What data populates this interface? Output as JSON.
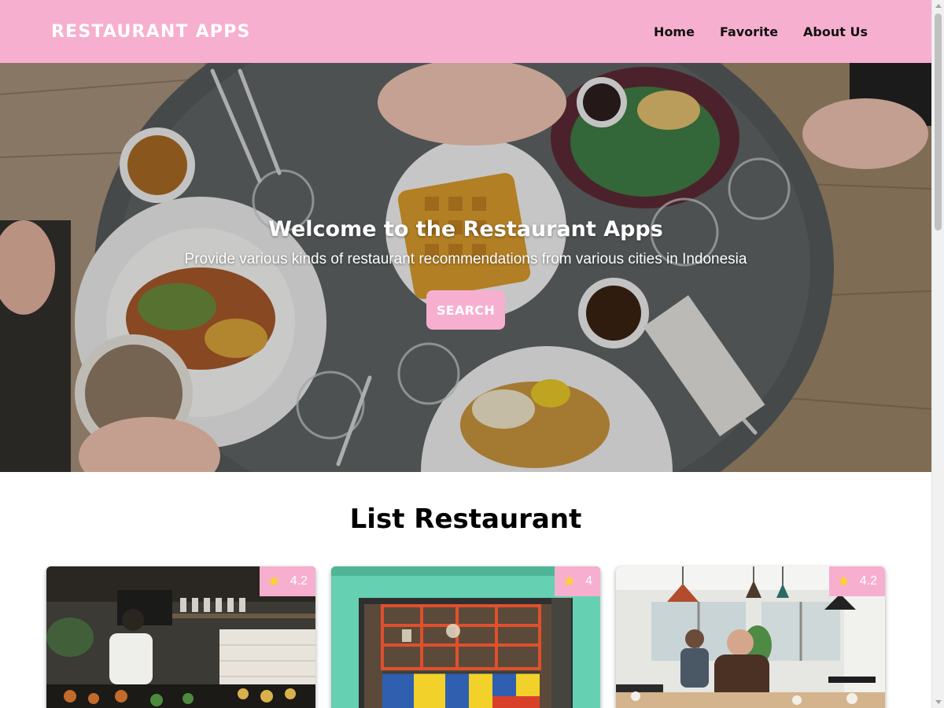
{
  "header": {
    "brand": "RESTAURANT APPS",
    "nav": [
      "Home",
      "Favorite",
      "About Us"
    ]
  },
  "hero": {
    "title": "Welcome to the Restaurant Apps",
    "subtitle": "Provide various kinds of restaurant recommendations from various cities in Indonesia",
    "button_label": "SEARCH"
  },
  "list": {
    "title": "List Restaurant",
    "restaurants": [
      {
        "rating": "4.2",
        "icon": "star-icon"
      },
      {
        "rating": "4",
        "icon": "star-icon"
      },
      {
        "rating": "4.2",
        "icon": "star-icon"
      }
    ]
  },
  "colors": {
    "accent": "#f7afcf",
    "star": "#ffd324"
  }
}
